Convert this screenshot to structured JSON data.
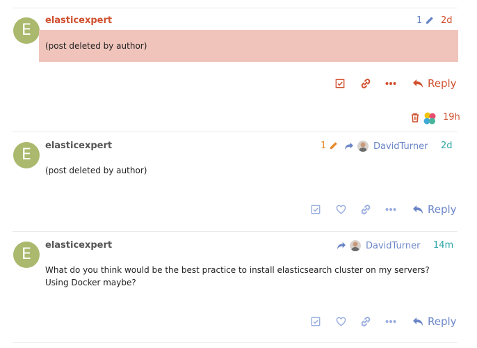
{
  "colors": {
    "accent_red": "#d0502e",
    "accent_blue": "#6a86c7",
    "avatar_bg": "#aab96d",
    "deleted_bg": "#f0c4bb",
    "edit_orange": "#e8892b",
    "time_teal": "#2fa6a6",
    "divider": "#e9e9e9",
    "muted_icon": "#9aaee0"
  },
  "posts": [
    {
      "avatar_letter": "E",
      "username": "elasticexpert",
      "body": "(post deleted by author)",
      "edit_count": "1",
      "time": "2d",
      "reply_label": "Reply",
      "deleted_by": {
        "time": "19h"
      }
    },
    {
      "avatar_letter": "E",
      "username": "elasticexpert",
      "body": "(post deleted by author)",
      "edit_count": "1",
      "reply_to_user": "DavidTurner",
      "time": "2d",
      "reply_label": "Reply"
    },
    {
      "avatar_letter": "E",
      "username": "elasticexpert",
      "body_lines": [
        "What do you think would be the best practice to install elasticsearch cluster on my servers?",
        "Using Docker maybe?"
      ],
      "reply_to_user": "DavidTurner",
      "time": "14m",
      "reply_label": "Reply"
    }
  ]
}
